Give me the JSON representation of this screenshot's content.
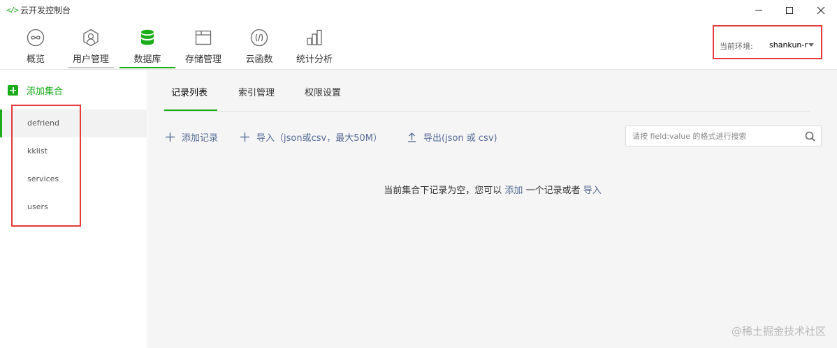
{
  "window": {
    "icon_text": "</>",
    "title": "云开发控制台"
  },
  "nav": {
    "tabs": [
      {
        "label": "概览",
        "icon": "overview-icon"
      },
      {
        "label": "用户管理",
        "icon": "user-icon"
      },
      {
        "label": "数据库",
        "icon": "database-icon"
      },
      {
        "label": "存储管理",
        "icon": "folder-icon"
      },
      {
        "label": "云函数",
        "icon": "function-icon"
      },
      {
        "label": "统计分析",
        "icon": "stats-icon"
      }
    ],
    "active": "数据库"
  },
  "env": {
    "label": "当前环境:",
    "value": "shankun-r"
  },
  "sidebar": {
    "add_label": "添加集合",
    "collections": [
      {
        "label": "defriend"
      },
      {
        "label": "kklist"
      },
      {
        "label": "services"
      },
      {
        "label": "users"
      }
    ],
    "active": "defriend"
  },
  "main": {
    "tabs": [
      {
        "label": "记录列表"
      },
      {
        "label": "索引管理"
      },
      {
        "label": "权限设置"
      }
    ],
    "active_tab": "记录列表",
    "actions": {
      "add_record": "添加记录",
      "import": "导入（json或csv，最大50M）",
      "export": "导出(json 或 csv)"
    },
    "search": {
      "placeholder": "请按 field:value 的格式进行搜索",
      "value": ""
    },
    "empty": {
      "prefix": "当前集合下记录为空，您可以",
      "add_link": "添加",
      "middle": "一个记录或者",
      "import_link": "导入"
    }
  },
  "watermark": "@稀土掘金技术社区",
  "colors": {
    "accent": "#1aad19",
    "link": "#576b95",
    "highlight_border": "#e5393b"
  }
}
